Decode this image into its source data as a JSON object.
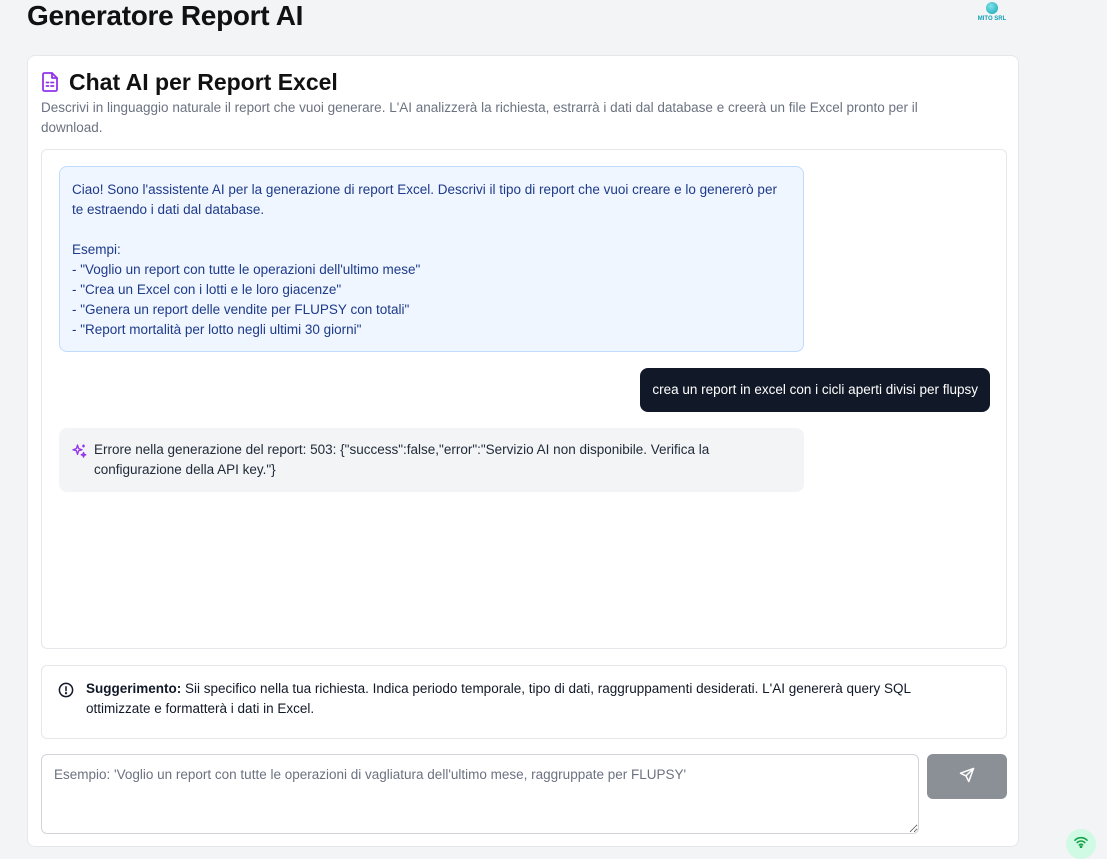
{
  "header": {
    "title": "Generatore Report AI",
    "logo_text": "MITO SRL"
  },
  "card": {
    "title": "Chat AI per Report Excel",
    "description": "Descrivi in linguaggio naturale il report che vuoi generare. L'AI analizzerà la richiesta, estrarrà i dati dal database e creerà un file Excel pronto per il download."
  },
  "chat": {
    "messages": [
      {
        "role": "assistant",
        "text": "Ciao! Sono l'assistente AI per la generazione di report Excel. Descrivi il tipo di report che vuoi creare e lo genererò per te estraendo i dati dal database.\n\nEsempi:\n- \"Voglio un report con tutte le operazioni dell'ultimo mese\"\n- \"Crea un Excel con i lotti e le loro giacenze\"\n- \"Genera un report delle vendite per FLUPSY con totali\"\n- \"Report mortalità per lotto negli ultimi 30 giorni\""
      },
      {
        "role": "user",
        "text": "crea un report in excel con i cicli aperti divisi per flupsy"
      },
      {
        "role": "error",
        "text": "Errore nella generazione del report: 503: {\"success\":false,\"error\":\"Servizio AI non disponibile. Verifica la configurazione della API key.\"}"
      }
    ]
  },
  "tip": {
    "label": "Suggerimento:",
    "text": "Sii specifico nella tua richiesta. Indica periodo temporale, tipo di dati, raggruppamenti desiderati. L'AI genererà query SQL ottimizzate e formatterà i dati in Excel."
  },
  "input": {
    "value": "",
    "placeholder": "Esempio: 'Voglio un report con tutte le operazioni di vagliatura dell'ultimo mese, raggruppate per FLUPSY'"
  },
  "icons": {
    "title_icon": "file-spreadsheet-icon",
    "error_icon": "sparkles-icon",
    "tip_icon": "alert-circle-icon",
    "send_icon": "send-icon",
    "status_icon": "wifi-icon"
  },
  "colors": {
    "accent": "#9333ea",
    "user_bubble": "#111827",
    "assistant_bubble": "#eff6ff",
    "error_bubble": "#f3f4f6",
    "send_button": "#8b8f96",
    "status_ok": "#22c55e"
  }
}
